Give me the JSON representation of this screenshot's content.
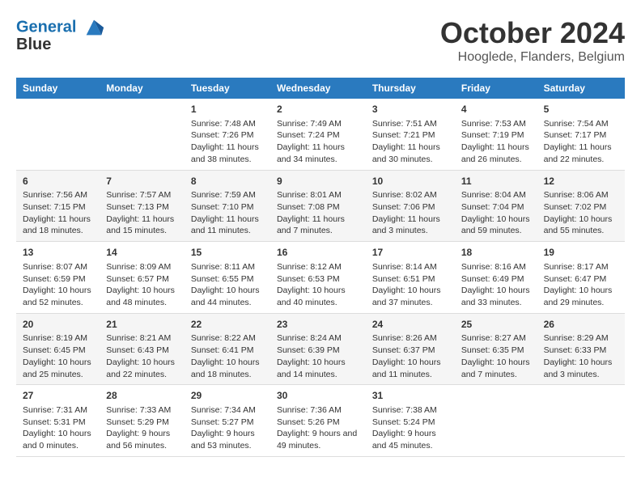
{
  "header": {
    "logo_line1": "General",
    "logo_line2": "Blue",
    "main_title": "October 2024",
    "subtitle": "Hooglede, Flanders, Belgium"
  },
  "calendar": {
    "days_of_week": [
      "Sunday",
      "Monday",
      "Tuesday",
      "Wednesday",
      "Thursday",
      "Friday",
      "Saturday"
    ],
    "weeks": [
      [
        {
          "day": "",
          "sunrise": "",
          "sunset": "",
          "daylight": ""
        },
        {
          "day": "",
          "sunrise": "",
          "sunset": "",
          "daylight": ""
        },
        {
          "day": "1",
          "sunrise": "Sunrise: 7:48 AM",
          "sunset": "Sunset: 7:26 PM",
          "daylight": "Daylight: 11 hours and 38 minutes."
        },
        {
          "day": "2",
          "sunrise": "Sunrise: 7:49 AM",
          "sunset": "Sunset: 7:24 PM",
          "daylight": "Daylight: 11 hours and 34 minutes."
        },
        {
          "day": "3",
          "sunrise": "Sunrise: 7:51 AM",
          "sunset": "Sunset: 7:21 PM",
          "daylight": "Daylight: 11 hours and 30 minutes."
        },
        {
          "day": "4",
          "sunrise": "Sunrise: 7:53 AM",
          "sunset": "Sunset: 7:19 PM",
          "daylight": "Daylight: 11 hours and 26 minutes."
        },
        {
          "day": "5",
          "sunrise": "Sunrise: 7:54 AM",
          "sunset": "Sunset: 7:17 PM",
          "daylight": "Daylight: 11 hours and 22 minutes."
        }
      ],
      [
        {
          "day": "6",
          "sunrise": "Sunrise: 7:56 AM",
          "sunset": "Sunset: 7:15 PM",
          "daylight": "Daylight: 11 hours and 18 minutes."
        },
        {
          "day": "7",
          "sunrise": "Sunrise: 7:57 AM",
          "sunset": "Sunset: 7:13 PM",
          "daylight": "Daylight: 11 hours and 15 minutes."
        },
        {
          "day": "8",
          "sunrise": "Sunrise: 7:59 AM",
          "sunset": "Sunset: 7:10 PM",
          "daylight": "Daylight: 11 hours and 11 minutes."
        },
        {
          "day": "9",
          "sunrise": "Sunrise: 8:01 AM",
          "sunset": "Sunset: 7:08 PM",
          "daylight": "Daylight: 11 hours and 7 minutes."
        },
        {
          "day": "10",
          "sunrise": "Sunrise: 8:02 AM",
          "sunset": "Sunset: 7:06 PM",
          "daylight": "Daylight: 11 hours and 3 minutes."
        },
        {
          "day": "11",
          "sunrise": "Sunrise: 8:04 AM",
          "sunset": "Sunset: 7:04 PM",
          "daylight": "Daylight: 10 hours and 59 minutes."
        },
        {
          "day": "12",
          "sunrise": "Sunrise: 8:06 AM",
          "sunset": "Sunset: 7:02 PM",
          "daylight": "Daylight: 10 hours and 55 minutes."
        }
      ],
      [
        {
          "day": "13",
          "sunrise": "Sunrise: 8:07 AM",
          "sunset": "Sunset: 6:59 PM",
          "daylight": "Daylight: 10 hours and 52 minutes."
        },
        {
          "day": "14",
          "sunrise": "Sunrise: 8:09 AM",
          "sunset": "Sunset: 6:57 PM",
          "daylight": "Daylight: 10 hours and 48 minutes."
        },
        {
          "day": "15",
          "sunrise": "Sunrise: 8:11 AM",
          "sunset": "Sunset: 6:55 PM",
          "daylight": "Daylight: 10 hours and 44 minutes."
        },
        {
          "day": "16",
          "sunrise": "Sunrise: 8:12 AM",
          "sunset": "Sunset: 6:53 PM",
          "daylight": "Daylight: 10 hours and 40 minutes."
        },
        {
          "day": "17",
          "sunrise": "Sunrise: 8:14 AM",
          "sunset": "Sunset: 6:51 PM",
          "daylight": "Daylight: 10 hours and 37 minutes."
        },
        {
          "day": "18",
          "sunrise": "Sunrise: 8:16 AM",
          "sunset": "Sunset: 6:49 PM",
          "daylight": "Daylight: 10 hours and 33 minutes."
        },
        {
          "day": "19",
          "sunrise": "Sunrise: 8:17 AM",
          "sunset": "Sunset: 6:47 PM",
          "daylight": "Daylight: 10 hours and 29 minutes."
        }
      ],
      [
        {
          "day": "20",
          "sunrise": "Sunrise: 8:19 AM",
          "sunset": "Sunset: 6:45 PM",
          "daylight": "Daylight: 10 hours and 25 minutes."
        },
        {
          "day": "21",
          "sunrise": "Sunrise: 8:21 AM",
          "sunset": "Sunset: 6:43 PM",
          "daylight": "Daylight: 10 hours and 22 minutes."
        },
        {
          "day": "22",
          "sunrise": "Sunrise: 8:22 AM",
          "sunset": "Sunset: 6:41 PM",
          "daylight": "Daylight: 10 hours and 18 minutes."
        },
        {
          "day": "23",
          "sunrise": "Sunrise: 8:24 AM",
          "sunset": "Sunset: 6:39 PM",
          "daylight": "Daylight: 10 hours and 14 minutes."
        },
        {
          "day": "24",
          "sunrise": "Sunrise: 8:26 AM",
          "sunset": "Sunset: 6:37 PM",
          "daylight": "Daylight: 10 hours and 11 minutes."
        },
        {
          "day": "25",
          "sunrise": "Sunrise: 8:27 AM",
          "sunset": "Sunset: 6:35 PM",
          "daylight": "Daylight: 10 hours and 7 minutes."
        },
        {
          "day": "26",
          "sunrise": "Sunrise: 8:29 AM",
          "sunset": "Sunset: 6:33 PM",
          "daylight": "Daylight: 10 hours and 3 minutes."
        }
      ],
      [
        {
          "day": "27",
          "sunrise": "Sunrise: 7:31 AM",
          "sunset": "Sunset: 5:31 PM",
          "daylight": "Daylight: 10 hours and 0 minutes."
        },
        {
          "day": "28",
          "sunrise": "Sunrise: 7:33 AM",
          "sunset": "Sunset: 5:29 PM",
          "daylight": "Daylight: 9 hours and 56 minutes."
        },
        {
          "day": "29",
          "sunrise": "Sunrise: 7:34 AM",
          "sunset": "Sunset: 5:27 PM",
          "daylight": "Daylight: 9 hours and 53 minutes."
        },
        {
          "day": "30",
          "sunrise": "Sunrise: 7:36 AM",
          "sunset": "Sunset: 5:26 PM",
          "daylight": "Daylight: 9 hours and 49 minutes."
        },
        {
          "day": "31",
          "sunrise": "Sunrise: 7:38 AM",
          "sunset": "Sunset: 5:24 PM",
          "daylight": "Daylight: 9 hours and 45 minutes."
        },
        {
          "day": "",
          "sunrise": "",
          "sunset": "",
          "daylight": ""
        },
        {
          "day": "",
          "sunrise": "",
          "sunset": "",
          "daylight": ""
        }
      ]
    ]
  }
}
